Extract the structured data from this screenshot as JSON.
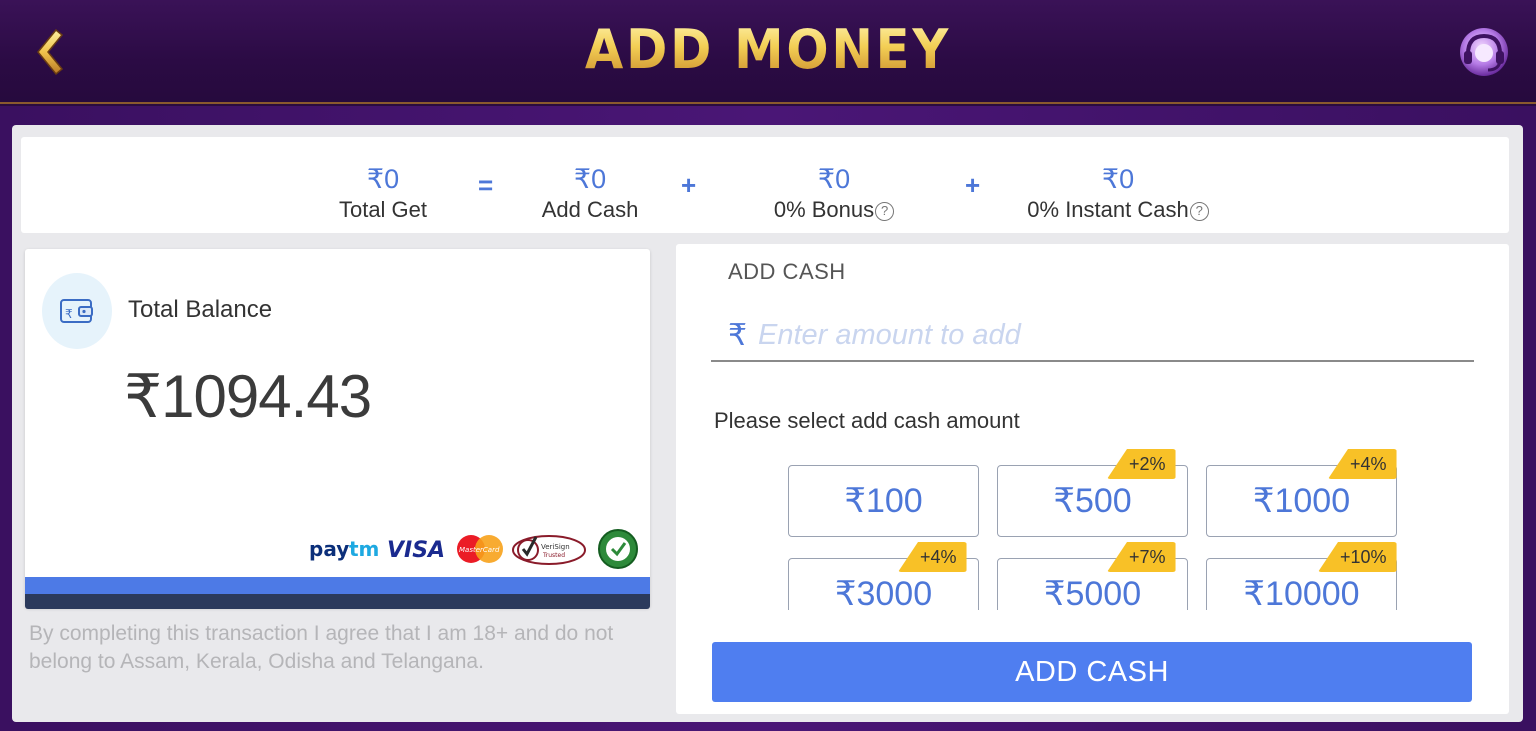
{
  "header": {
    "title": "ADD MONEY",
    "back_icon": "chevron-left-icon",
    "support_icon": "headset-support-icon"
  },
  "summary": {
    "total_get": {
      "value": "₹0",
      "label": "Total Get"
    },
    "equals": "=",
    "add_cash": {
      "value": "₹0",
      "label": "Add Cash"
    },
    "plus": "+",
    "bonus": {
      "value": "₹0",
      "label": "0% Bonus"
    },
    "instant_cash": {
      "value": "₹0",
      "label": "0% Instant Cash"
    },
    "help_icon": "?"
  },
  "balance": {
    "label": "Total Balance",
    "amount": "₹1094.43",
    "wallet_icon": "wallet-icon",
    "payment_logos": {
      "paytm": "Paytm",
      "visa": "VISA",
      "mastercard": "MasterCard",
      "verisign": "VeriSign Trusted",
      "seal": "secure-seal"
    }
  },
  "disclaimer": "By completing this transaction I agree that I am 18+ and do not belong to Assam, Kerala, Odisha and Telangana.",
  "add_cash": {
    "title": "ADD CASH",
    "currency_symbol": "₹",
    "placeholder": "Enter amount to add",
    "value": "",
    "select_label": "Please select add cash amount",
    "amounts": [
      {
        "label": "₹100",
        "bonus": ""
      },
      {
        "label": "₹500",
        "bonus": "+2%"
      },
      {
        "label": "₹1000",
        "bonus": "+4%"
      },
      {
        "label": "₹3000",
        "bonus": "+4%"
      },
      {
        "label": "₹5000",
        "bonus": "+7%"
      },
      {
        "label": "₹10000",
        "bonus": "+10%"
      }
    ],
    "button_label": "ADD CASH"
  },
  "colors": {
    "accent": "#4d77d8",
    "button": "#4f7ef0",
    "tag": "#f8c127",
    "header_bg": "#2b0b44",
    "title_gold": "#f3cf55"
  }
}
